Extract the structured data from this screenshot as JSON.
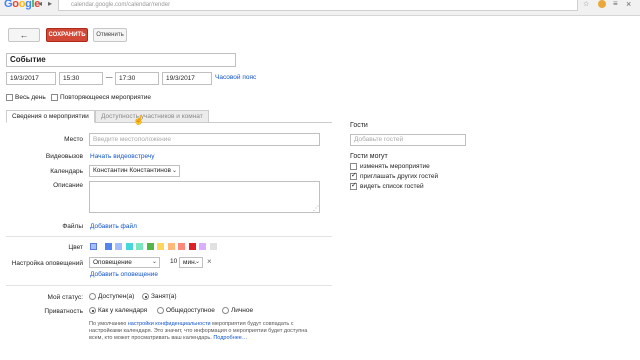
{
  "browser": {
    "url": "calendar.google.com/calendar/render",
    "logo": "Google"
  },
  "toolbar": {
    "back_label": "←",
    "save_label": "СОХРАНИТЬ",
    "cancel_label": "Отменить"
  },
  "event": {
    "title": "Событие",
    "start_date": "19/3/2017",
    "start_time": "15:30",
    "dash": "—",
    "end_time": "17:30",
    "end_date": "19/3/2017",
    "timezone_link": "Часовой пояс",
    "all_day_label": "Весь день",
    "repeat_label": "Повторяющееся мероприятие"
  },
  "tabs": {
    "details": "Сведения о мероприятии",
    "availability": "Доступность участников и комнат"
  },
  "form": {
    "location_label": "Место",
    "location_placeholder": "Введите местоположение",
    "video_label": "Видеовызов",
    "video_link": "Начать видеовстречу",
    "calendar_label": "Календарь",
    "calendar_value": "Константин Константинов",
    "description_label": "Описание",
    "files_label": "Файлы",
    "files_link": "Добавить файл",
    "color_label": "Цвет",
    "notify_label": "Настройка оповещений",
    "notify_type": "Оповещение",
    "notify_amount": "10",
    "notify_unit": "мин.",
    "notify_remove": "×",
    "add_notify_link": "Добавить оповещение",
    "status_label": "Мой статус:",
    "status_options": [
      "Доступен(а)",
      "Занят(а)"
    ],
    "privacy_label": "Приватность",
    "privacy_options": [
      "Как у календаря",
      "Общедоступное",
      "Личное"
    ],
    "note_pre": "По умолчанию ",
    "note_link": "настройки конфиденциальности",
    "note_line1_rest": " мероприятия будут совпадать с",
    "note_line2": "настройками календаря. Это значит, что информация о мероприятии будет доступна",
    "note_line3": "всем, кто может просматривать ваш календарь. ",
    "note_more": "Подробнее…"
  },
  "colors": {
    "accent": "#d14836",
    "link": "#1155cc",
    "swatches": [
      "#a4bdfc",
      "#5484ed",
      "#a4bdfc",
      "#46d6db",
      "#7ae7bf",
      "#51b749",
      "#fbd75b",
      "#ffb878",
      "#ff887c",
      "#dc2127",
      "#dbadff",
      "#e1e1e1"
    ]
  },
  "guests": {
    "title": "Гости",
    "add_placeholder": "Добавьте гостей",
    "can_title": "Гости могут",
    "permissions": [
      {
        "label": "изменять мероприятие",
        "checked": false
      },
      {
        "label": "приглашать других гостей",
        "checked": true
      },
      {
        "label": "видеть список гостей",
        "checked": true
      }
    ]
  }
}
